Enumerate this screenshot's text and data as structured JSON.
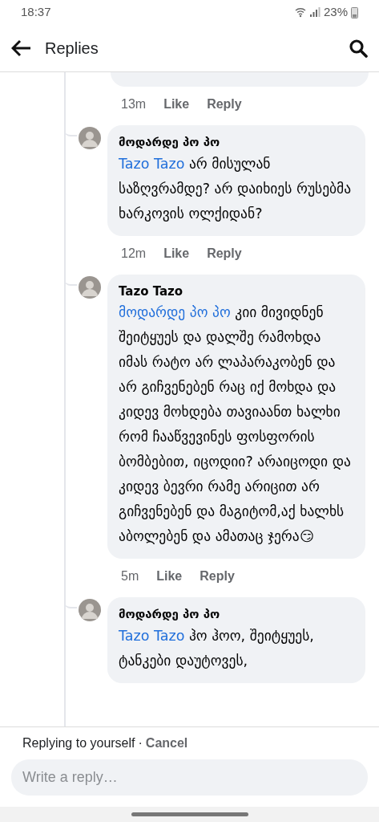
{
  "status_bar": {
    "time": "18:37",
    "battery": "23%"
  },
  "header": {
    "title": "Replies"
  },
  "comments": [
    {
      "kind": "cut",
      "actions": {
        "time": "13m",
        "like": "Like",
        "reply": "Reply"
      }
    },
    {
      "kind": "full",
      "author": "მოდარდე პო პო",
      "mention": "Tazo Tazo",
      "text": "არ მისულან საზღვრამდე? არ დაიხიეს რუსებმა ხარკოვის ოლქიდან?",
      "actions": {
        "time": "12m",
        "like": "Like",
        "reply": "Reply"
      }
    },
    {
      "kind": "full",
      "author": "Tazo Tazo",
      "mention": "მოდარდე პო პო",
      "text": "კიი მივიდნენ შეიტყუეს და დალშე რამოხდა იმას რატო არ ლაპარაკობენ და არ გიჩვენებენ რაც იქ მოხდა და კიდევ მოხდება თავიაანთ ხალხი რომ ჩააწვევინეს ფოსფორის ბომბებით, იცოდიი? არაიცოდი და კიდევ ბევრი რამე არიცით არ გიჩვენებენ და მაგიტომ,აქ ხალხს აბოლებენ და ამათაც ჯერა😏",
      "actions": {
        "time": "5m",
        "like": "Like",
        "reply": "Reply"
      }
    },
    {
      "kind": "full",
      "author": "მოდარდე პო პო",
      "mention": "Tazo Tazo",
      "text": "ჰო ჰოო, შეიტყუეს, ტანკები დაუტოვეს,"
    }
  ],
  "footer": {
    "replying": "Replying to yourself",
    "separator": "·",
    "cancel": "Cancel",
    "placeholder": "Write a reply…"
  }
}
